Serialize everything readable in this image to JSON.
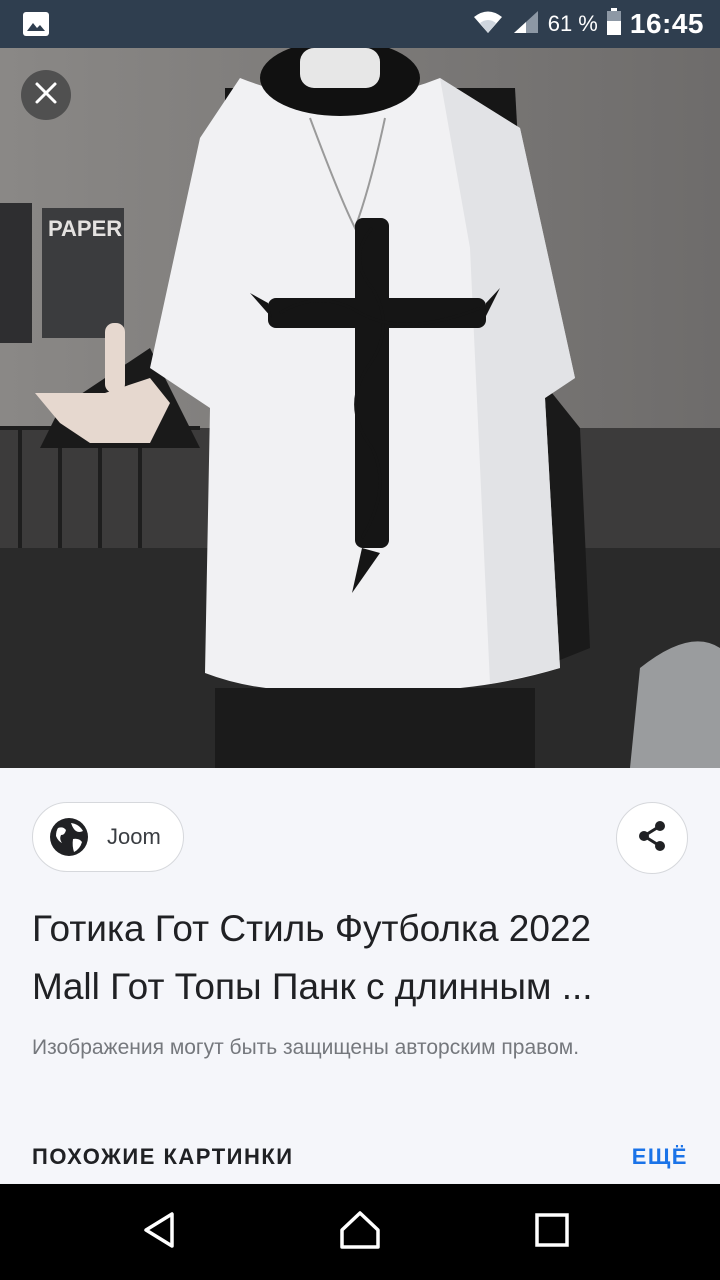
{
  "status_bar": {
    "battery_percent": "61 %",
    "time": "16:45",
    "icons": [
      "image-notification-icon",
      "wifi-icon",
      "signal-icon",
      "battery-icon"
    ]
  },
  "viewer": {
    "close_icon": "close-icon",
    "poster_text": "PAPER"
  },
  "source": {
    "name": "Joom",
    "icon": "globe-icon"
  },
  "share_icon": "share-icon",
  "title_lines": [
    "Готика Гот Стиль Футболка 2022",
    "Mall Гот Топы Панк с длинным ..."
  ],
  "copyright_note": "Изображения могут быть защищены авторским правом.",
  "similar": {
    "label": "ПОХОЖИЕ КАРТИНКИ",
    "more_label": "ЕЩЁ"
  },
  "nav": {
    "back_icon": "back-triangle-icon",
    "home_icon": "home-icon",
    "recents_icon": "recents-square-icon"
  },
  "colors": {
    "status_bar": "#2f3e4f",
    "accent": "#1a73e8",
    "info_background": "#f5f6fa",
    "nav_bar": "#000000"
  }
}
